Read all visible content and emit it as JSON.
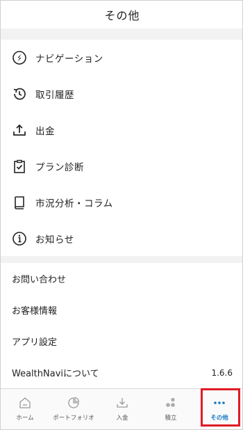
{
  "header": {
    "title": "その他"
  },
  "menu": [
    {
      "label": "ナビゲーション",
      "icon": "navigation-icon"
    },
    {
      "label": "取引履歴",
      "icon": "history-icon"
    },
    {
      "label": "出金",
      "icon": "withdraw-icon"
    },
    {
      "label": "プラン診断",
      "icon": "plan-clipboard-icon"
    },
    {
      "label": "市況分析・コラム",
      "icon": "book-icon"
    },
    {
      "label": "お知らせ",
      "icon": "info-icon"
    }
  ],
  "sub": [
    {
      "label": "お問い合わせ"
    },
    {
      "label": "お客様情報"
    },
    {
      "label": "アプリ設定"
    },
    {
      "label": "WealthNaviについて",
      "value": "1.6.6"
    }
  ],
  "tabs": [
    {
      "label": "ホーム",
      "icon": "home-icon"
    },
    {
      "label": "ポートフォリオ",
      "icon": "portfolio-icon"
    },
    {
      "label": "入金",
      "icon": "deposit-icon"
    },
    {
      "label": "積立",
      "icon": "accumulate-icon"
    },
    {
      "label": "その他",
      "icon": "more-icon",
      "active": true
    }
  ],
  "colors": {
    "accent": "#1677c4",
    "highlight": "#e01b24",
    "divider": "#f2f2f2"
  }
}
